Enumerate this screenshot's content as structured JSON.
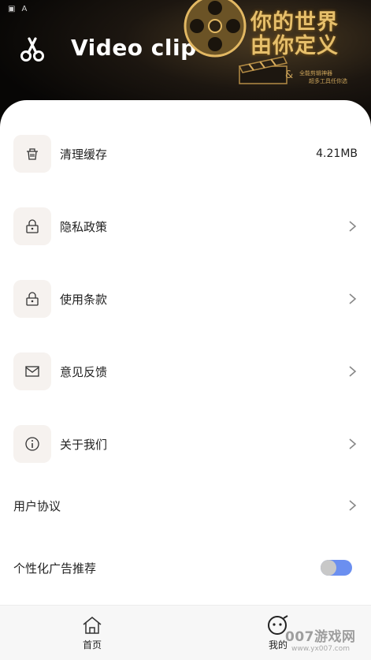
{
  "header": {
    "title": "Video clip",
    "slogan_line1": "你的世界",
    "slogan_line2": "由你定义",
    "slogan_amp": "&",
    "slogan_small1": "全能剪辑神器",
    "slogan_small2": "超多工具任你选"
  },
  "status_bar": {
    "icon1": "▣",
    "icon2": "A"
  },
  "settings": {
    "clear_cache": {
      "label": "清理缓存",
      "value": "4.21MB",
      "icon": "trash-icon"
    },
    "privacy": {
      "label": "隐私政策",
      "icon": "lock-icon"
    },
    "terms": {
      "label": "使用条款",
      "icon": "lock-icon"
    },
    "feedback": {
      "label": "意见反馈",
      "icon": "mail-icon"
    },
    "about": {
      "label": "关于我们",
      "icon": "info-icon"
    },
    "user_agreement": {
      "label": "用户协议"
    },
    "personalized_ads": {
      "label": "个性化广告推荐",
      "enabled": true
    }
  },
  "bottom_nav": {
    "home": {
      "label": "首页",
      "icon": "home-icon"
    },
    "mine": {
      "label": "我的",
      "icon": "face-icon"
    }
  },
  "watermark": {
    "text": "007游戏网",
    "url": "www.yx007.com"
  },
  "colors": {
    "icon_bg": "#f6f2ef",
    "toggle_track": "#6b8ff0",
    "slogan_gold": "#e6bf6b"
  }
}
